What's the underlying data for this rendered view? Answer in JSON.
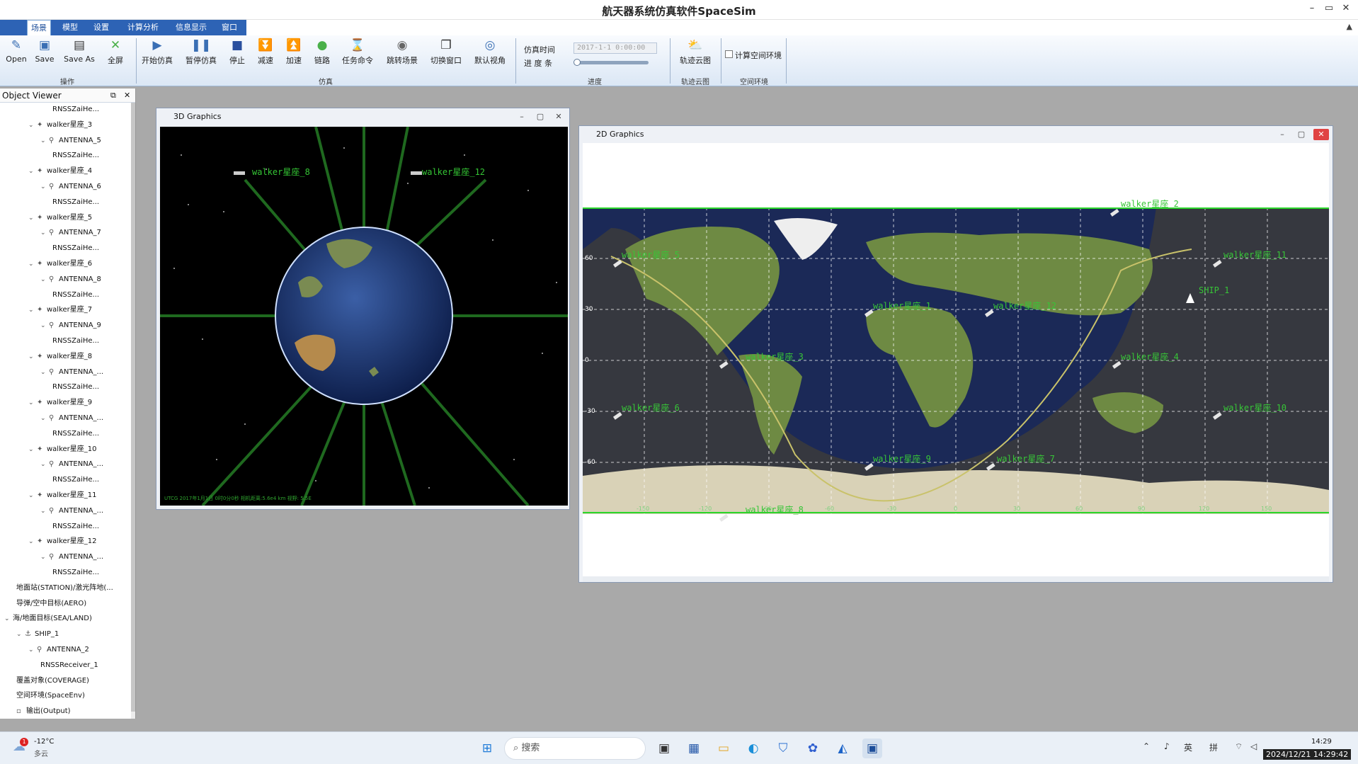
{
  "app": {
    "title": "航天器系统仿真软件SpaceSim"
  },
  "menu": [
    "场景",
    "模型",
    "设置",
    "计算分析",
    "信息显示",
    "窗口"
  ],
  "ribbon": {
    "ops": [
      "Open",
      "Save",
      "Save As",
      "全屏"
    ],
    "ops_group": "操作",
    "sim": [
      "开始仿真",
      "暂停仿真",
      "停止",
      "减速",
      "加速",
      "链路",
      "任务命令",
      "跳转场景",
      "切换窗口",
      "默认视角"
    ],
    "sim_group": "仿真",
    "progress": {
      "time_label": "仿真时间",
      "bar_label": "进 度 条",
      "time_value": "2017-1-1 0:00:00",
      "group": "进度",
      "level": 0.0
    },
    "cloud": {
      "label": "轨迹云图",
      "group": "轨迹云图"
    },
    "env": {
      "label": "计算空间环境",
      "group": "空间环境"
    }
  },
  "object_viewer": {
    "title": "Object Viewer",
    "items": [
      {
        "label": "RNSSZaiHe...",
        "indent": 4,
        "arrow": "",
        "icon": ""
      },
      {
        "label": "walker星座_3",
        "indent": 2,
        "arrow": "v",
        "icon": "sat"
      },
      {
        "label": "ANTENNA_5",
        "indent": 3,
        "arrow": "v",
        "icon": "ant"
      },
      {
        "label": "RNSSZaiHe...",
        "indent": 4,
        "arrow": "",
        "icon": ""
      },
      {
        "label": "walker星座_4",
        "indent": 2,
        "arrow": "v",
        "icon": "sat"
      },
      {
        "label": "ANTENNA_6",
        "indent": 3,
        "arrow": "v",
        "icon": "ant"
      },
      {
        "label": "RNSSZaiHe...",
        "indent": 4,
        "arrow": "",
        "icon": ""
      },
      {
        "label": "walker星座_5",
        "indent": 2,
        "arrow": "v",
        "icon": "sat"
      },
      {
        "label": "ANTENNA_7",
        "indent": 3,
        "arrow": "v",
        "icon": "ant"
      },
      {
        "label": "RNSSZaiHe...",
        "indent": 4,
        "arrow": "",
        "icon": ""
      },
      {
        "label": "walker星座_6",
        "indent": 2,
        "arrow": "v",
        "icon": "sat"
      },
      {
        "label": "ANTENNA_8",
        "indent": 3,
        "arrow": "v",
        "icon": "ant"
      },
      {
        "label": "RNSSZaiHe...",
        "indent": 4,
        "arrow": "",
        "icon": ""
      },
      {
        "label": "walker星座_7",
        "indent": 2,
        "arrow": "v",
        "icon": "sat"
      },
      {
        "label": "ANTENNA_9",
        "indent": 3,
        "arrow": "v",
        "icon": "ant"
      },
      {
        "label": "RNSSZaiHe...",
        "indent": 4,
        "arrow": "",
        "icon": ""
      },
      {
        "label": "walker星座_8",
        "indent": 2,
        "arrow": "v",
        "icon": "sat"
      },
      {
        "label": "ANTENNA_...",
        "indent": 3,
        "arrow": "v",
        "icon": "ant"
      },
      {
        "label": "RNSSZaiHe...",
        "indent": 4,
        "arrow": "",
        "icon": ""
      },
      {
        "label": "walker星座_9",
        "indent": 2,
        "arrow": "v",
        "icon": "sat"
      },
      {
        "label": "ANTENNA_...",
        "indent": 3,
        "arrow": "v",
        "icon": "ant"
      },
      {
        "label": "RNSSZaiHe...",
        "indent": 4,
        "arrow": "",
        "icon": ""
      },
      {
        "label": "walker星座_10",
        "indent": 2,
        "arrow": "v",
        "icon": "sat"
      },
      {
        "label": "ANTENNA_...",
        "indent": 3,
        "arrow": "v",
        "icon": "ant"
      },
      {
        "label": "RNSSZaiHe...",
        "indent": 4,
        "arrow": "",
        "icon": ""
      },
      {
        "label": "walker星座_11",
        "indent": 2,
        "arrow": "v",
        "icon": "sat"
      },
      {
        "label": "ANTENNA_...",
        "indent": 3,
        "arrow": "v",
        "icon": "ant"
      },
      {
        "label": "RNSSZaiHe...",
        "indent": 4,
        "arrow": "",
        "icon": ""
      },
      {
        "label": "walker星座_12",
        "indent": 2,
        "arrow": "v",
        "icon": "sat"
      },
      {
        "label": "ANTENNA_...",
        "indent": 3,
        "arrow": "v",
        "icon": "ant"
      },
      {
        "label": "RNSSZaiHe...",
        "indent": 4,
        "arrow": "",
        "icon": ""
      },
      {
        "label": "地面站(STATION)/激光阵地(...",
        "indent": 1,
        "arrow": "",
        "icon": ""
      },
      {
        "label": "导弹/空中目标(AERO)",
        "indent": 1,
        "arrow": "",
        "icon": ""
      },
      {
        "label": "海/地面目标(SEA/LAND)",
        "indent": 0,
        "arrow": "v",
        "icon": ""
      },
      {
        "label": "SHIP_1",
        "indent": 1,
        "arrow": "v",
        "icon": "ship"
      },
      {
        "label": "ANTENNA_2",
        "indent": 2,
        "arrow": "v",
        "icon": "ant"
      },
      {
        "label": "RNSSReceiver_1",
        "indent": 3,
        "arrow": "",
        "icon": ""
      },
      {
        "label": "覆盖对象(COVERAGE)",
        "indent": 1,
        "arrow": "",
        "icon": ""
      },
      {
        "label": "空间环境(SpaceEnv)",
        "indent": 1,
        "arrow": "",
        "icon": ""
      },
      {
        "label": "输出(Output)",
        "indent": 1,
        "arrow": "",
        "icon": "out"
      }
    ]
  },
  "win3d": {
    "title": "3D Graphics",
    "sats": [
      "walker星座_8",
      "walker星座_12"
    ],
    "status": "UTCG 2017年1月1日 0时0分0秒 相机距离:5.6e4 km 视野: 5.5E"
  },
  "win2d": {
    "title": "2D Graphics",
    "lat_labels": [
      "60",
      "30",
      "0",
      "-30",
      "-60"
    ],
    "lon_labels": [
      "-150",
      "-120",
      "-90",
      "-60",
      "-30",
      "0",
      "30",
      "60",
      "90",
      "120",
      "150"
    ],
    "sats": [
      "walker星座_2",
      "walker星座_5",
      "walker星座_11",
      "walker星座_1",
      "walker星座_12",
      "walker星座_3",
      "walker星座_4",
      "walker星座_6",
      "walker星座_10",
      "walker星座_9",
      "walker星座_7",
      "walker星座_8"
    ],
    "ship": "SHIP_1"
  },
  "taskbar": {
    "weather_temp": "-12°C",
    "weather_desc": "多云",
    "weather_badge": "1",
    "search": "搜索",
    "ime1": "英",
    "ime2": "拼",
    "time": "14:29",
    "date": "2024/12/21 14:29:42"
  }
}
